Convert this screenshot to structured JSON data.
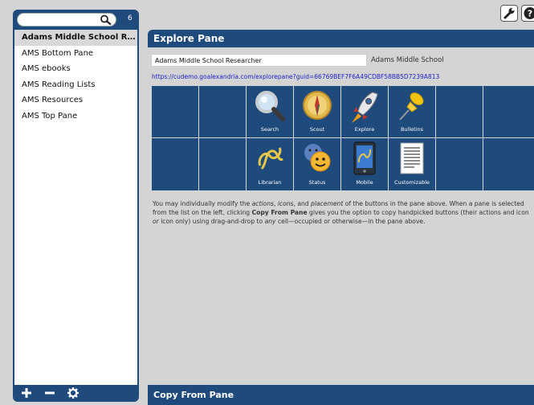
{
  "sidebar": {
    "search": {
      "placeholder": "",
      "count": "6"
    },
    "items": [
      {
        "label": "Adams Middle School Researcher",
        "selected": true
      },
      {
        "label": "AMS Bottom Pane"
      },
      {
        "label": "AMS ebooks"
      },
      {
        "label": "AMS Reading Lists"
      },
      {
        "label": "AMS Resources"
      },
      {
        "label": "AMS Top Pane"
      }
    ],
    "footer": {
      "add_icon": "plus-icon",
      "remove_icon": "minus-icon",
      "settings_icon": "gear-icon"
    }
  },
  "toolbar": {
    "tools_icon": "wrench-icon",
    "help_icon": "help-icon"
  },
  "main": {
    "pane_title": "Explore Pane",
    "pane_name": "Adams Middle School Researcher",
    "school": "Adams Middle School",
    "url": "https://cudemo.goalexandria.com/explorepane?guid=66769BEF7F6A49CDBF58BB5D7239A813",
    "grid": {
      "row1": [
        "",
        "",
        "Search",
        "Scout",
        "Explore",
        "Bulletins",
        "",
        ""
      ],
      "row2": [
        "",
        "",
        "Librarian",
        "Status",
        "Mobile",
        "Customizable",
        "",
        ""
      ]
    },
    "description": {
      "t1": "You may individually modify the ",
      "e1": "actions",
      "t2": ", ",
      "e2": "icons",
      "t3": ", and ",
      "e3": "placement",
      "t4": " of the buttons in the pane above. When a pane is selected from the list on the left, clicking ",
      "b1": "Copy From Pane",
      "t5": " gives you the option to copy handpicked buttons (their actions and icon ",
      "e4": "or",
      "t6": " icon only) using drag-and-drop to ",
      "e5": "any",
      "t7": " cell—occupied or otherwise—in the pane above."
    },
    "copy_title": "Copy From Pane"
  },
  "colors": {
    "navy": "#1f4a7c",
    "background": "#d4d4d4",
    "link": "#2222cc"
  }
}
